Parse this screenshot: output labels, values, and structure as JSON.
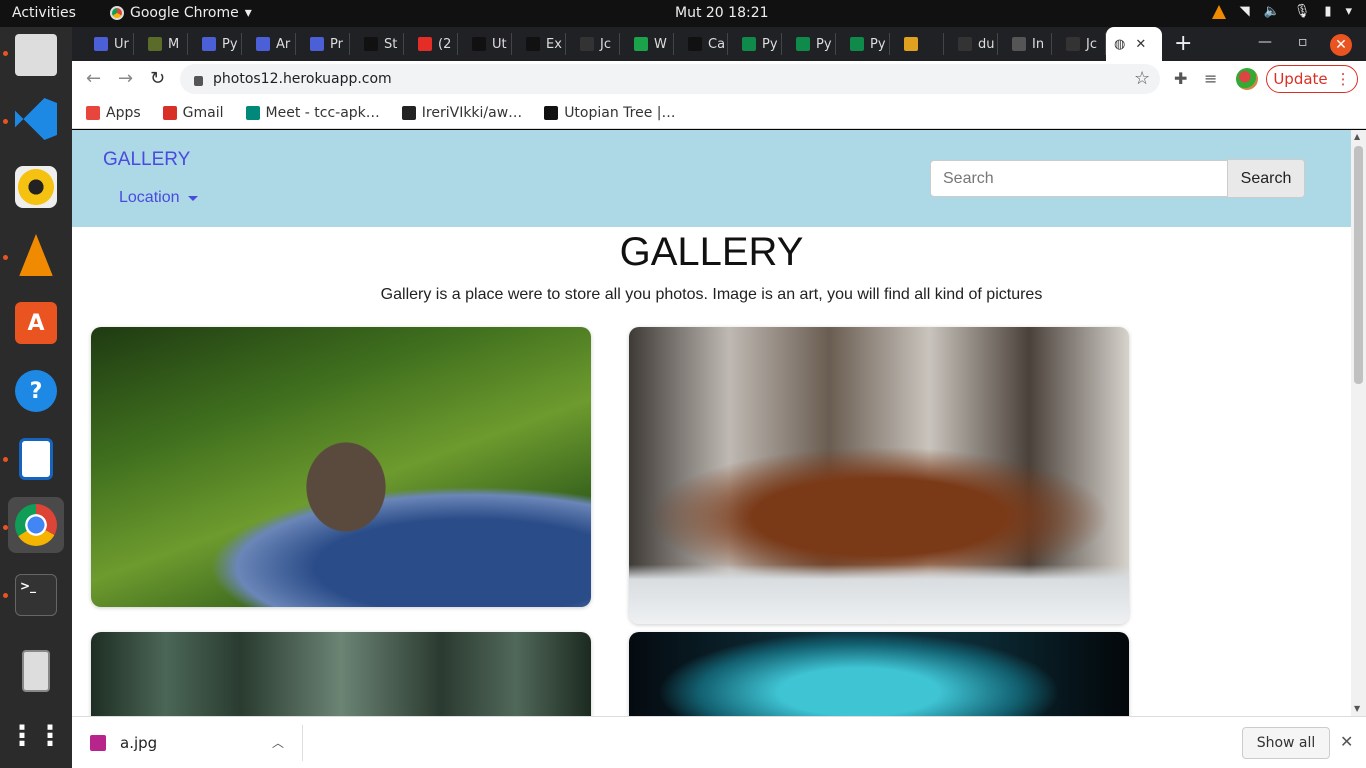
{
  "system": {
    "activities": "Activities",
    "app_name": "Google Chrome",
    "clock": "Mut 20  18:21"
  },
  "tabs": [
    {
      "label": "Ur",
      "color": "#4b5fd6"
    },
    {
      "label": "M",
      "color": "#5a6b2a"
    },
    {
      "label": "Py",
      "color": "#4b5fd6"
    },
    {
      "label": "Ar",
      "color": "#4b5fd6"
    },
    {
      "label": "Pr",
      "color": "#4b5fd6"
    },
    {
      "label": "St",
      "color": "#111111"
    },
    {
      "label": "(2",
      "color": "#e52d27"
    },
    {
      "label": "Ut",
      "color": "#111111"
    },
    {
      "label": "Ex",
      "color": "#111111"
    },
    {
      "label": "Jc",
      "color": "#333333"
    },
    {
      "label": "W",
      "color": "#1aa34a"
    },
    {
      "label": "Ca",
      "color": "#111111"
    },
    {
      "label": "Py",
      "color": "#0f8a4a"
    },
    {
      "label": "Py",
      "color": "#0f8a4a"
    },
    {
      "label": "Py",
      "color": "#0f8a4a"
    },
    {
      "label": "",
      "color": "#e0a020"
    },
    {
      "label": "du",
      "color": "#333333"
    },
    {
      "label": "In",
      "color": "#555555"
    },
    {
      "label": "Jc",
      "color": "#333333"
    }
  ],
  "browser": {
    "url": "photos12.herokuapp.com",
    "update_label": "Update"
  },
  "bookmarks": [
    {
      "label": "Apps",
      "color": "#e8453c"
    },
    {
      "label": "Gmail",
      "color": "#d93025"
    },
    {
      "label": "Meet - tcc-apk…",
      "color": "#00897b"
    },
    {
      "label": "IreriVIkki/aw…",
      "color": "#222222"
    },
    {
      "label": "Utopian Tree |…",
      "color": "#111111"
    }
  ],
  "page": {
    "brand": "GALLERY",
    "location_label": "Location",
    "search_placeholder": "Search",
    "search_button": "Search",
    "heading": "GALLERY",
    "subtitle": "Gallery is a place were to store all you photos. Image is an art, you will find all kind of pictures"
  },
  "download": {
    "filename": "a.jpg",
    "show_all": "Show all"
  }
}
